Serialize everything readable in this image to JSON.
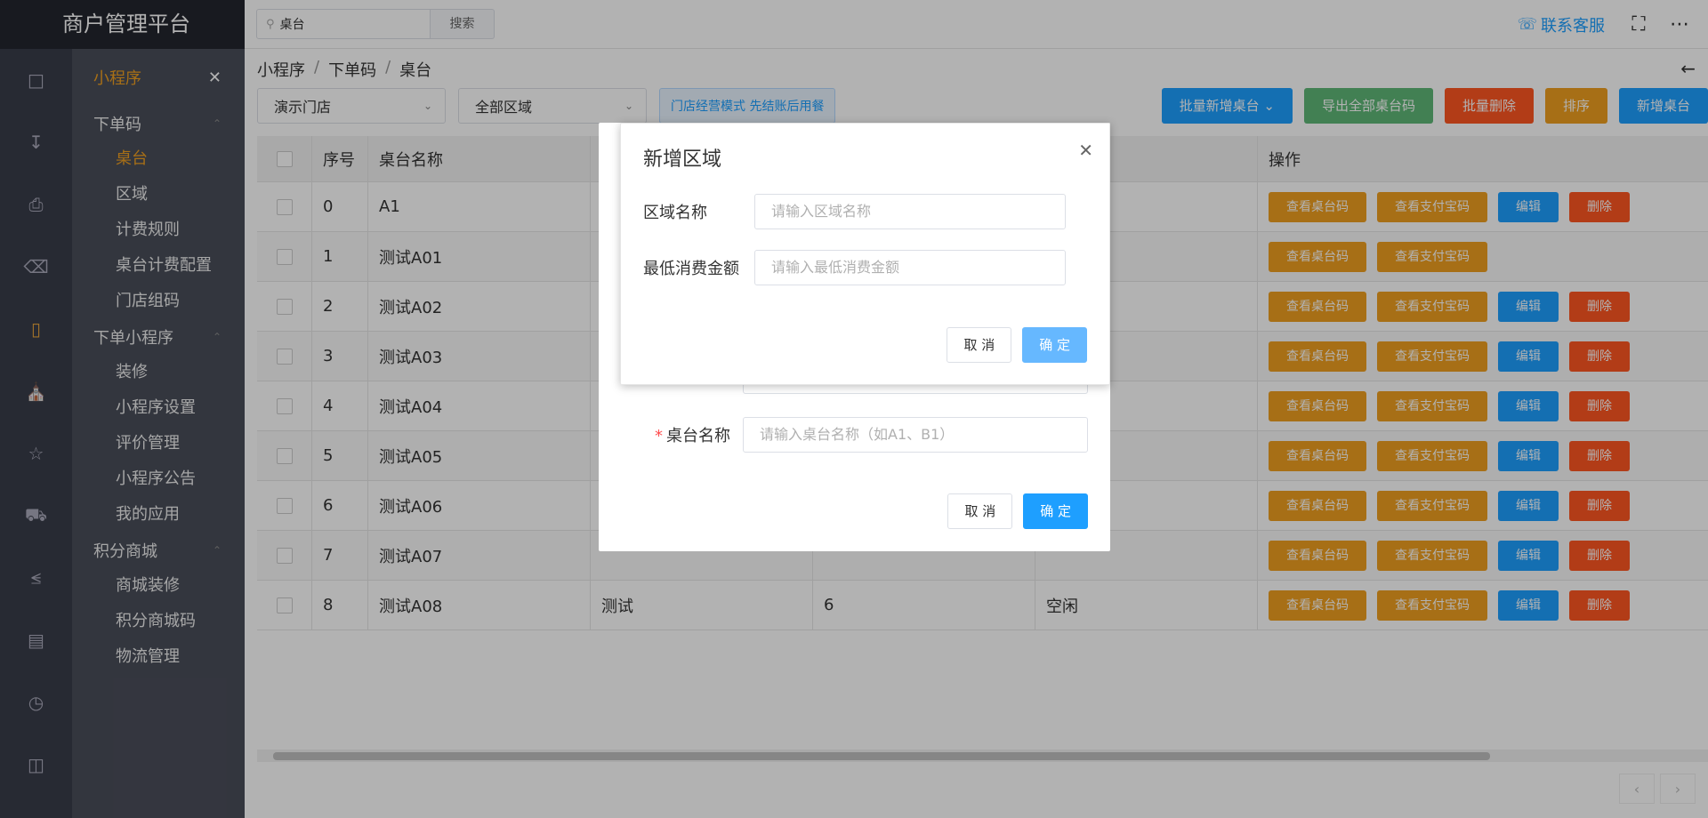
{
  "app": {
    "title": "商户管理平台"
  },
  "search": {
    "value": "桌台",
    "button": "搜索"
  },
  "header": {
    "support": "联系客服"
  },
  "sidebar": {
    "title": "小程序",
    "groups": [
      {
        "title": "下单码",
        "items": [
          "桌台",
          "区域",
          "计费规则",
          "桌台计费配置",
          "门店组码"
        ]
      },
      {
        "title": "下单小程序",
        "items": [
          "装修",
          "小程序设置",
          "评价管理",
          "小程序公告",
          "我的应用"
        ]
      },
      {
        "title": "积分商城",
        "items": [
          "商城装修",
          "积分商城码",
          "物流管理"
        ]
      }
    ],
    "active_item": "桌台"
  },
  "breadcrumb": [
    "小程序",
    "下单码",
    "桌台"
  ],
  "filters": {
    "store": "演示门店",
    "area": "全部区域",
    "mode_tag": "门店经营模式 先结账后用餐"
  },
  "actions": {
    "batch_add": "批量新增桌台",
    "export": "导出全部桌台码",
    "batch_delete": "批量删除",
    "sort": "排序",
    "add": "新增桌台"
  },
  "table": {
    "headers": {
      "no": "序号",
      "name": "桌台名称",
      "op": "操作"
    },
    "row_buttons": {
      "view_code": "查看桌台码",
      "view_pay": "查看支付宝码",
      "edit": "编辑",
      "delete": "删除"
    },
    "rows": [
      {
        "no": "0",
        "name": "A1",
        "area": "",
        "seats": "",
        "status": ""
      },
      {
        "no": "1",
        "name": "测试A01",
        "area": "",
        "seats": "",
        "status": ""
      },
      {
        "no": "2",
        "name": "测试A02",
        "area": "",
        "seats": "",
        "status": ""
      },
      {
        "no": "3",
        "name": "测试A03",
        "area": "",
        "seats": "",
        "status": ""
      },
      {
        "no": "4",
        "name": "测试A04",
        "area": "",
        "seats": "",
        "status": ""
      },
      {
        "no": "5",
        "name": "测试A05",
        "area": "",
        "seats": "",
        "status": ""
      },
      {
        "no": "6",
        "name": "测试A06",
        "area": "",
        "seats": "",
        "status": ""
      },
      {
        "no": "7",
        "name": "测试A07",
        "area": "",
        "seats": "",
        "status": ""
      },
      {
        "no": "8",
        "name": "测试A08",
        "area": "测试",
        "seats": "6",
        "status": "空闲"
      }
    ]
  },
  "back_dialog": {
    "field_label": "桌台名称",
    "field_placeholder": "请输入桌台名称（如A1、B1）",
    "cancel": "取 消",
    "confirm": "确 定"
  },
  "front_dialog": {
    "title": "新增区域",
    "area_name_label": "区域名称",
    "area_name_placeholder": "请输入区域名称",
    "min_spend_label": "最低消费金额",
    "min_spend_placeholder": "请输入最低消费金额",
    "cancel": "取 消",
    "confirm": "确 定"
  },
  "colors": {
    "accent": "#1e9fff",
    "orange": "#f0a020",
    "green": "#5fb878",
    "red": "#ff5722",
    "sidebar": "#393d49"
  }
}
